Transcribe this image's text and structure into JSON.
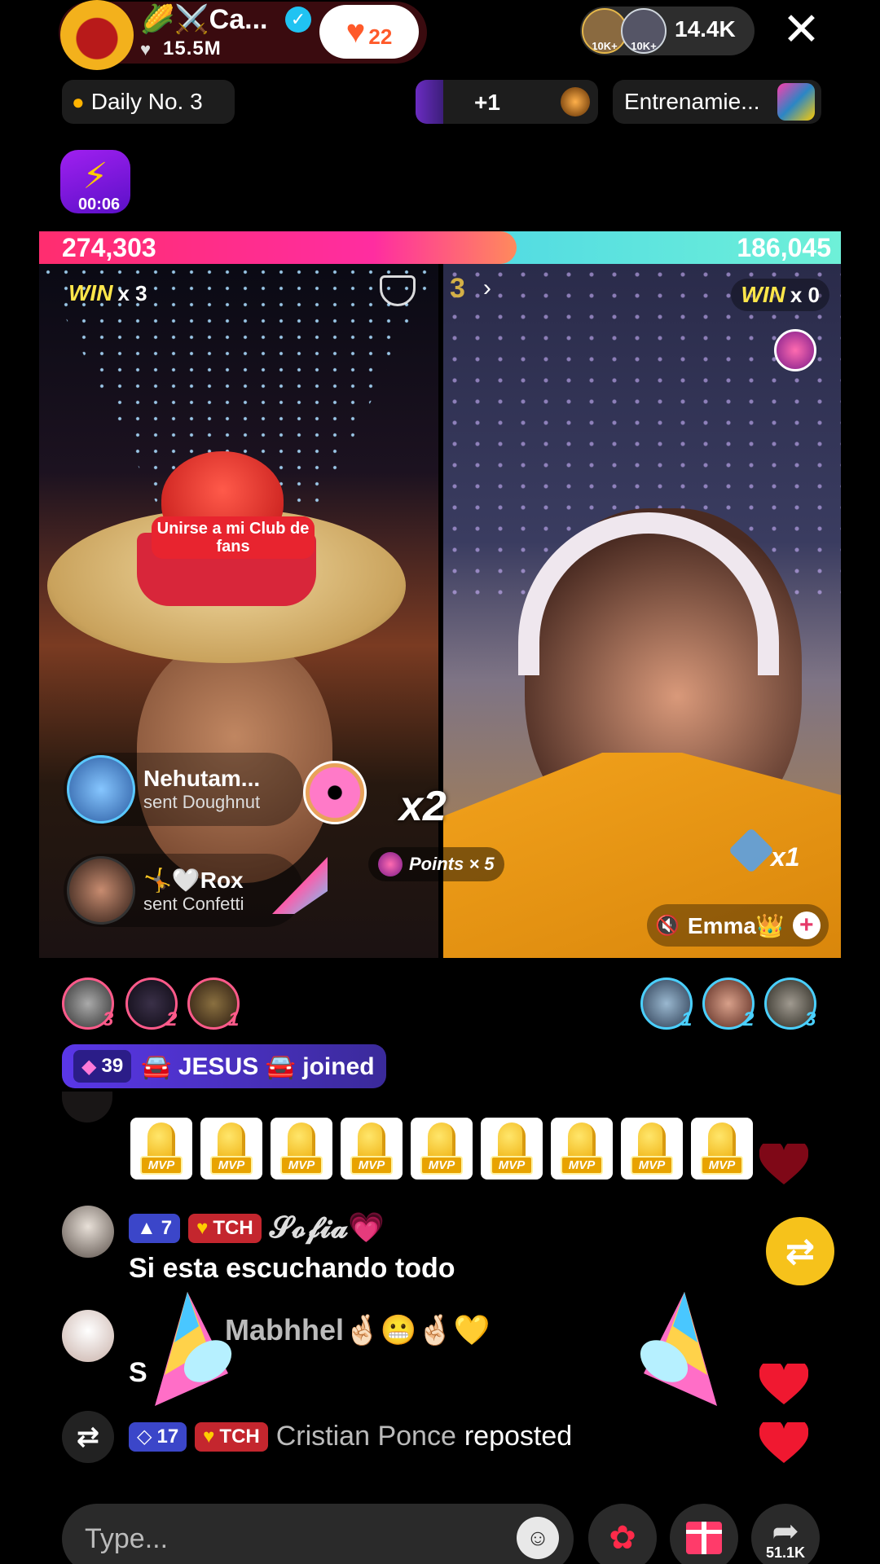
{
  "header": {
    "host_name": "🌽⚔️Ca...",
    "host_likes": "15.5M",
    "fan_club_count": "22",
    "viewers": "14.4K",
    "viewer_badges": [
      "10K+",
      "10K+"
    ]
  },
  "promos": {
    "daily": "Daily No. 3",
    "plus_one": "+1",
    "event": "Entrenamie..."
  },
  "energy_timer": "00:06",
  "battle": {
    "left_score": "274,303",
    "right_score": "186,045",
    "left_wins": "x 3",
    "right_wins": "x 0",
    "win_label": "WIN",
    "round": "3",
    "left_hat_text": "Unirse a mi Club de fans",
    "multiplier_big": "x2",
    "points_text": "Points × 5",
    "right_multiplier": "x1",
    "right_name": "Emma👑"
  },
  "gifts": [
    {
      "user": "Nehutam...",
      "action": "sent Doughnut"
    },
    {
      "user": "🤸🤍Rox",
      "action": "sent Confetti"
    }
  ],
  "left_ranks": [
    "3",
    "2",
    "1"
  ],
  "right_ranks": [
    "1",
    "2",
    "3"
  ],
  "joined": {
    "level": "39",
    "text": "🚘 JESUS 🚘 joined"
  },
  "mvp_label": "MVP",
  "mvp_count": 9,
  "chat": [
    {
      "level": "7",
      "club": "TCH",
      "name": "𝓢𝓸𝓯𝓲𝓪💗",
      "message": "Si esta escuchando todo"
    },
    {
      "name": "Mabhhel🤞🏻😬🤞🏻💛",
      "message": "S"
    }
  ],
  "repost": {
    "level": "17",
    "club": "TCH",
    "user": "Cristian Ponce",
    "action": "reposted"
  },
  "bottom": {
    "placeholder": "Type...",
    "share_count": "51.1K"
  },
  "colors": {
    "left_bar": "#ff2d6f",
    "right_bar": "#2ee6e0",
    "fanclub": "#ff5a2a",
    "level": "#3b46c9",
    "club": "#c4262e"
  }
}
